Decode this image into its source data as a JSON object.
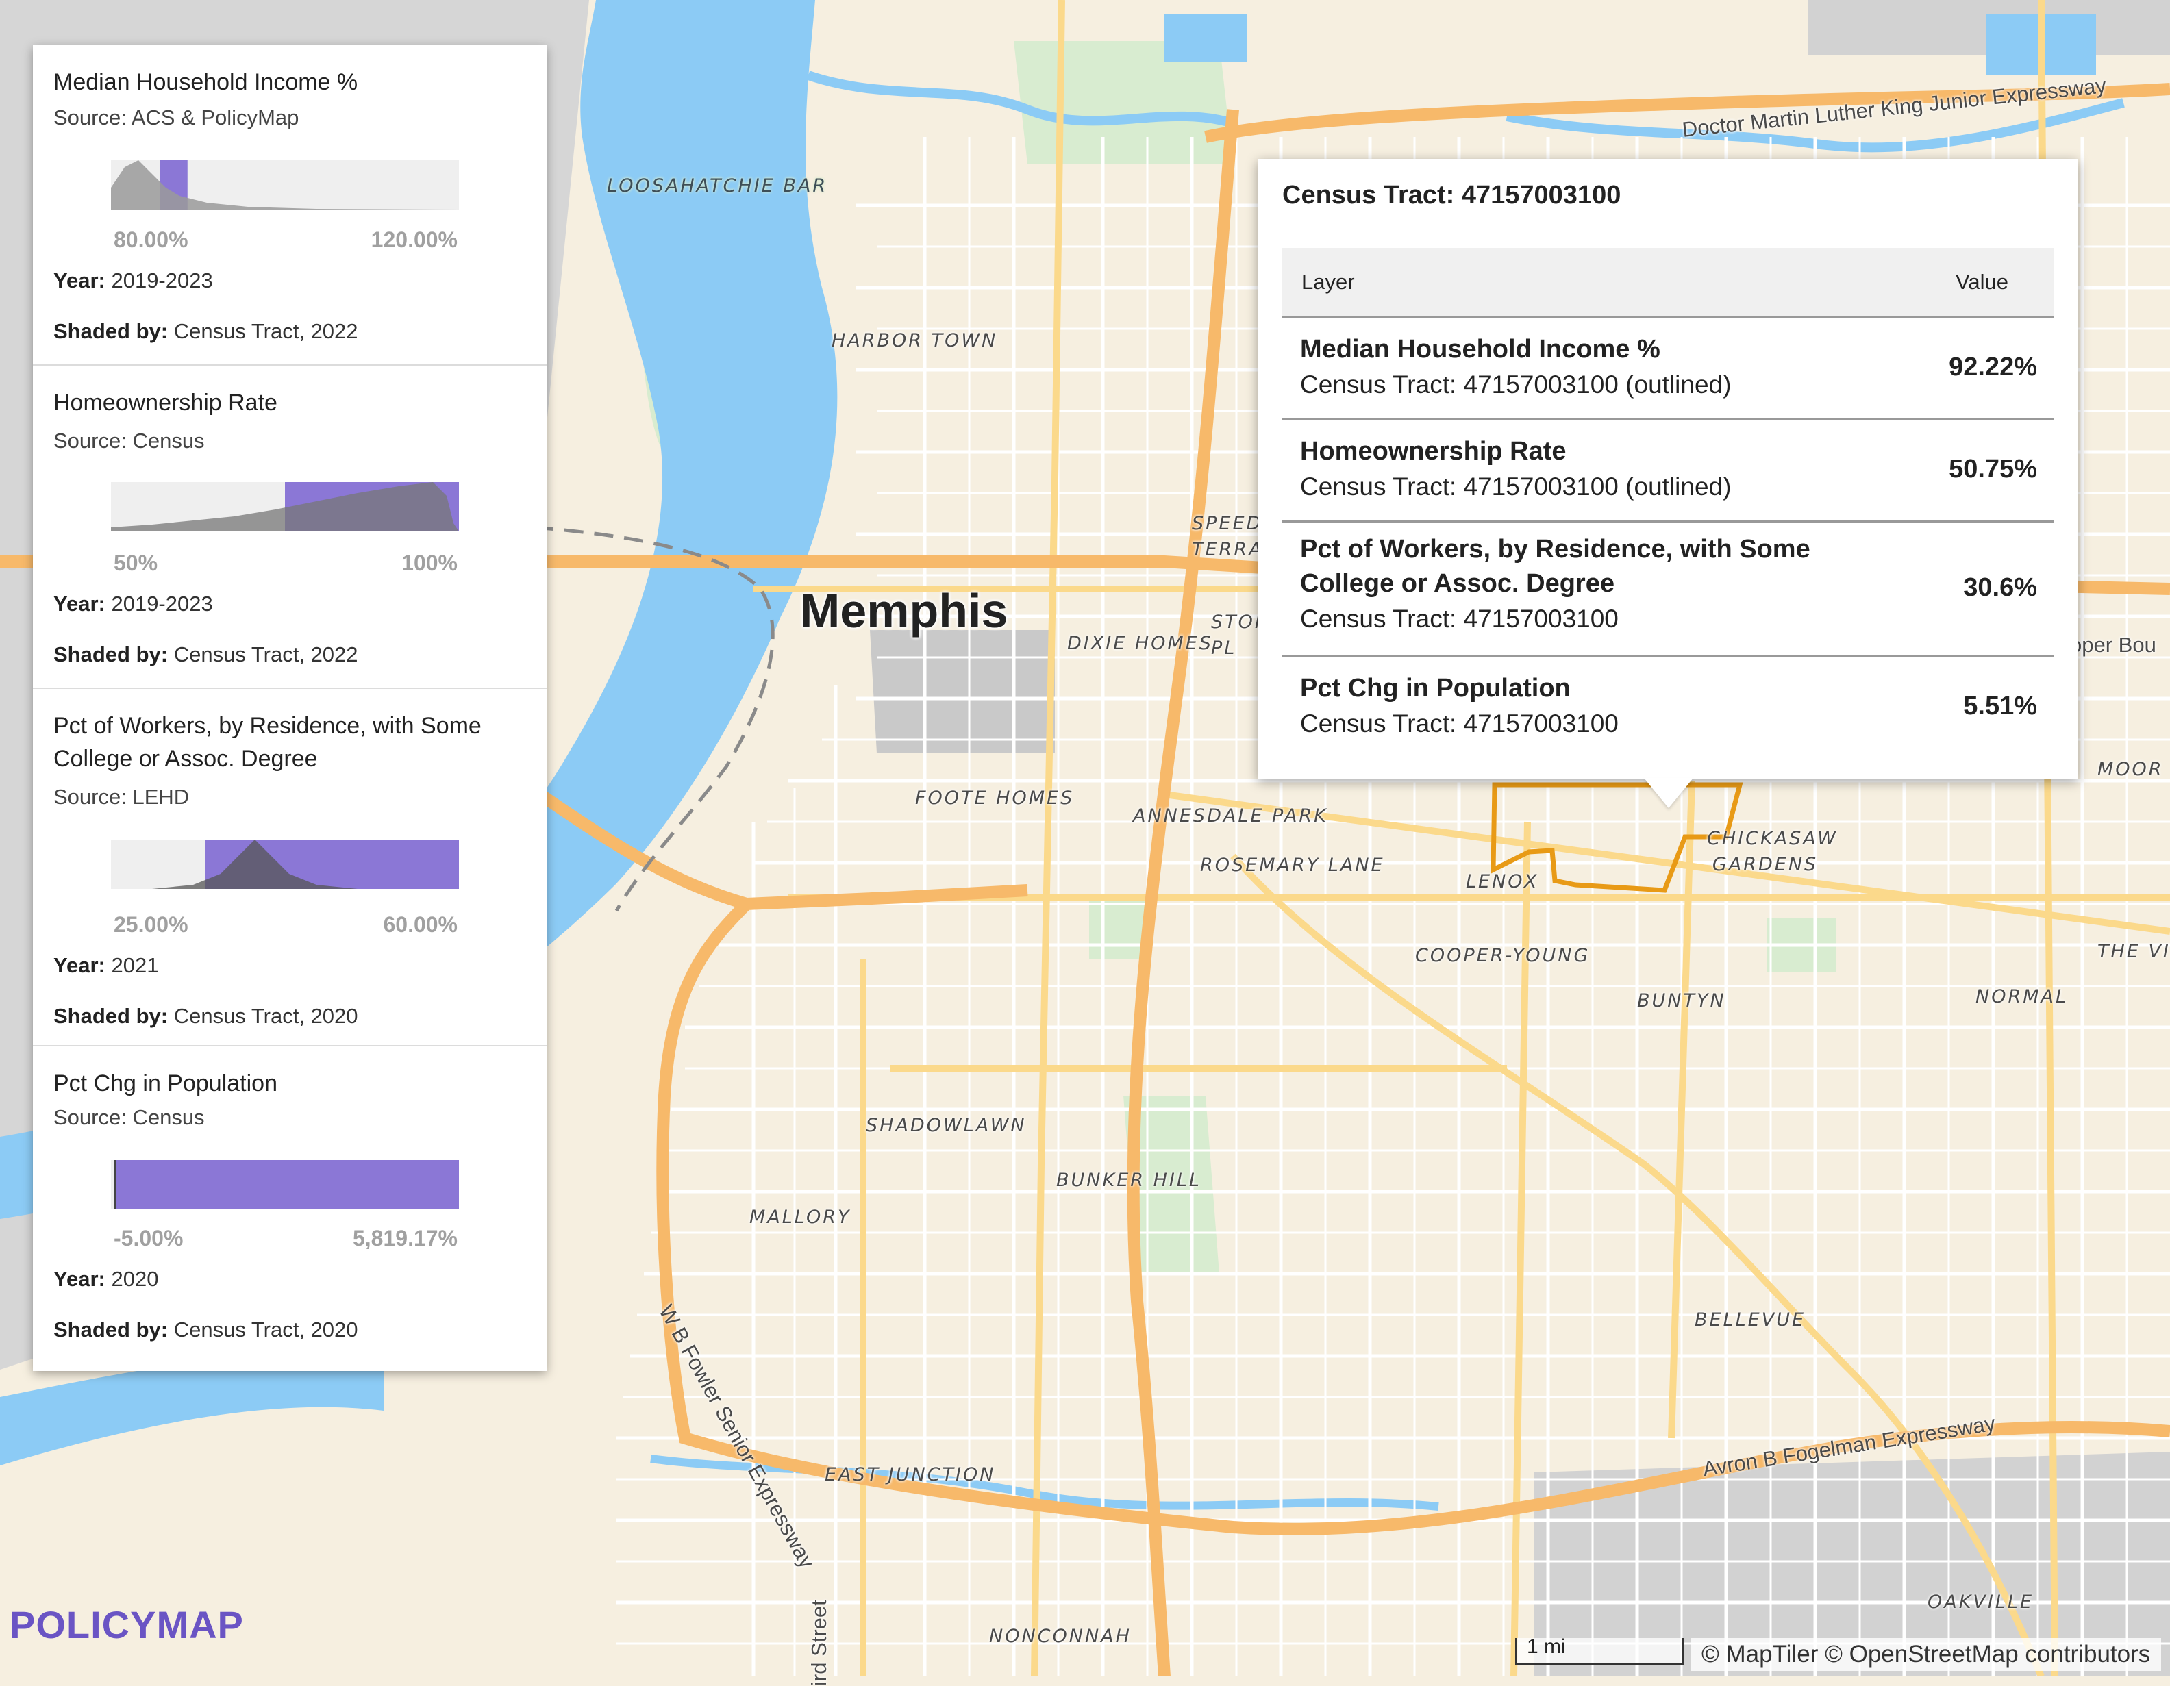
{
  "map": {
    "city_label": "Memphis",
    "neighborhood_labels": [
      "LOOSAHATCHIE BAR",
      "HARBOR TOWN",
      "DIXIE HOMES",
      "SPEEDW TERRA",
      "STON PL",
      "FOOTE HOMES",
      "ANNESDALE PARK",
      "ROSEMARY LANE",
      "LENOX",
      "CHICKASAW GARDENS",
      "COOPER-YOUNG",
      "BUNTYN",
      "NORMAL",
      "THE VIL",
      "MOOR",
      "SHADOWLAWN",
      "BUNKER HILL",
      "MALLORY",
      "BELLEVUE",
      "EAST JUNCTION",
      "NONCONNAH",
      "OAKVILLE"
    ],
    "road_labels": [
      "Doctor Martin Luther King Junior Expressway",
      "W B Fowler Senior Expressway",
      "Avron B Fogelman Expressway",
      "oper Bou",
      "ird Street"
    ],
    "colors": {
      "land": "#f6efe0",
      "water": "#8ccbf5",
      "park": "#d8ecd0",
      "industrial": "#cfcfcf",
      "highway": "#f7b96a",
      "major_road": "#fbd98b",
      "tract_outline": "#e89a16"
    }
  },
  "legend": {
    "items": [
      {
        "title": "Median Household Income %",
        "source": "Source: ACS & PolicyMap",
        "min": "80.00%",
        "max": "120.00%",
        "year_label": "Year:",
        "year": "2019-2023",
        "shaded_label": "Shaded by:",
        "shaded": "Census Tract, 2022",
        "highlight_fraction": [
          0.14,
          0.22
        ]
      },
      {
        "title": "Homeownership Rate",
        "source": "Source: Census",
        "min": "50%",
        "max": "100%",
        "year_label": "Year:",
        "year": "2019-2023",
        "shaded_label": "Shaded by:",
        "shaded": "Census Tract, 2022",
        "highlight_fraction": [
          0.5,
          1.0
        ]
      },
      {
        "title": "Pct of Workers, by Residence, with Some College or Assoc. Degree",
        "source": "Source: LEHD",
        "min": "25.00%",
        "max": "60.00%",
        "year_label": "Year:",
        "year": "2021",
        "shaded_label": "Shaded by:",
        "shaded": "Census Tract, 2020",
        "highlight_fraction": [
          0.27,
          1.0
        ]
      },
      {
        "title": "Pct Chg in Population",
        "source": "Source: Census",
        "min": "-5.00%",
        "max": "5,819.17%",
        "year_label": "Year:",
        "year": "2020",
        "shaded_label": "Shaded by:",
        "shaded": "Census Tract, 2020",
        "highlight_fraction": [
          0.01,
          1.0
        ]
      }
    ],
    "accent_color": "#8b77d6"
  },
  "popup": {
    "title": "Census Tract: 47157003100",
    "col_layer": "Layer",
    "col_value": "Value",
    "rows": [
      {
        "name": "Median Household Income %",
        "sub": "Census Tract: 47157003100 (outlined)",
        "value": "92.22%"
      },
      {
        "name": "Homeownership Rate",
        "sub": "Census Tract: 47157003100 (outlined)",
        "value": "50.75%"
      },
      {
        "name": "Pct of Workers, by Residence, with Some College or Assoc. Degree",
        "sub": "Census Tract: 47157003100",
        "value": "30.6%"
      },
      {
        "name": "Pct Chg in Population",
        "sub": "Census Tract: 47157003100",
        "value": "5.51%"
      }
    ]
  },
  "footer": {
    "logo": "POLICYMAP",
    "scale": "1 mi",
    "attribution": "© MapTiler © OpenStreetMap contributors"
  }
}
